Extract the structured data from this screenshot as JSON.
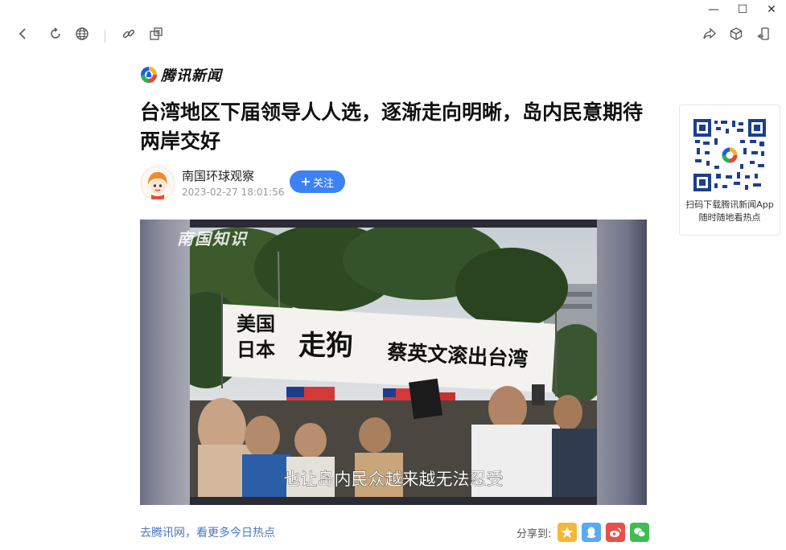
{
  "window": {
    "minimize": "—",
    "maximize": "☐",
    "close": "✕"
  },
  "site": {
    "name": "腾讯新闻"
  },
  "article": {
    "title": "台湾地区下届领导人人选，逐渐走向明晰，岛内民意期待两岸交好",
    "author": "南国环球观察",
    "time": "2023-02-27 18:01:56",
    "follow_label": "关注",
    "media_watermark": "南国知识",
    "media_subtitle": "也让岛内民众越来越无法忍受",
    "banner_text": "美国日本走狗蔡英文滚出台湾"
  },
  "footer": {
    "more_link": "去腾讯网，看更多今日热点",
    "share_label": "分享到:"
  },
  "qr": {
    "line1": "扫码下载腾讯新闻App",
    "line2": "随时随地看热点"
  },
  "colors": {
    "follow": "#3d82f5",
    "link": "#4a78c0",
    "qzone": "#f5b73b",
    "qq": "#5aa9f2",
    "weibo": "#e8514a",
    "wechat": "#3fbd4f"
  }
}
